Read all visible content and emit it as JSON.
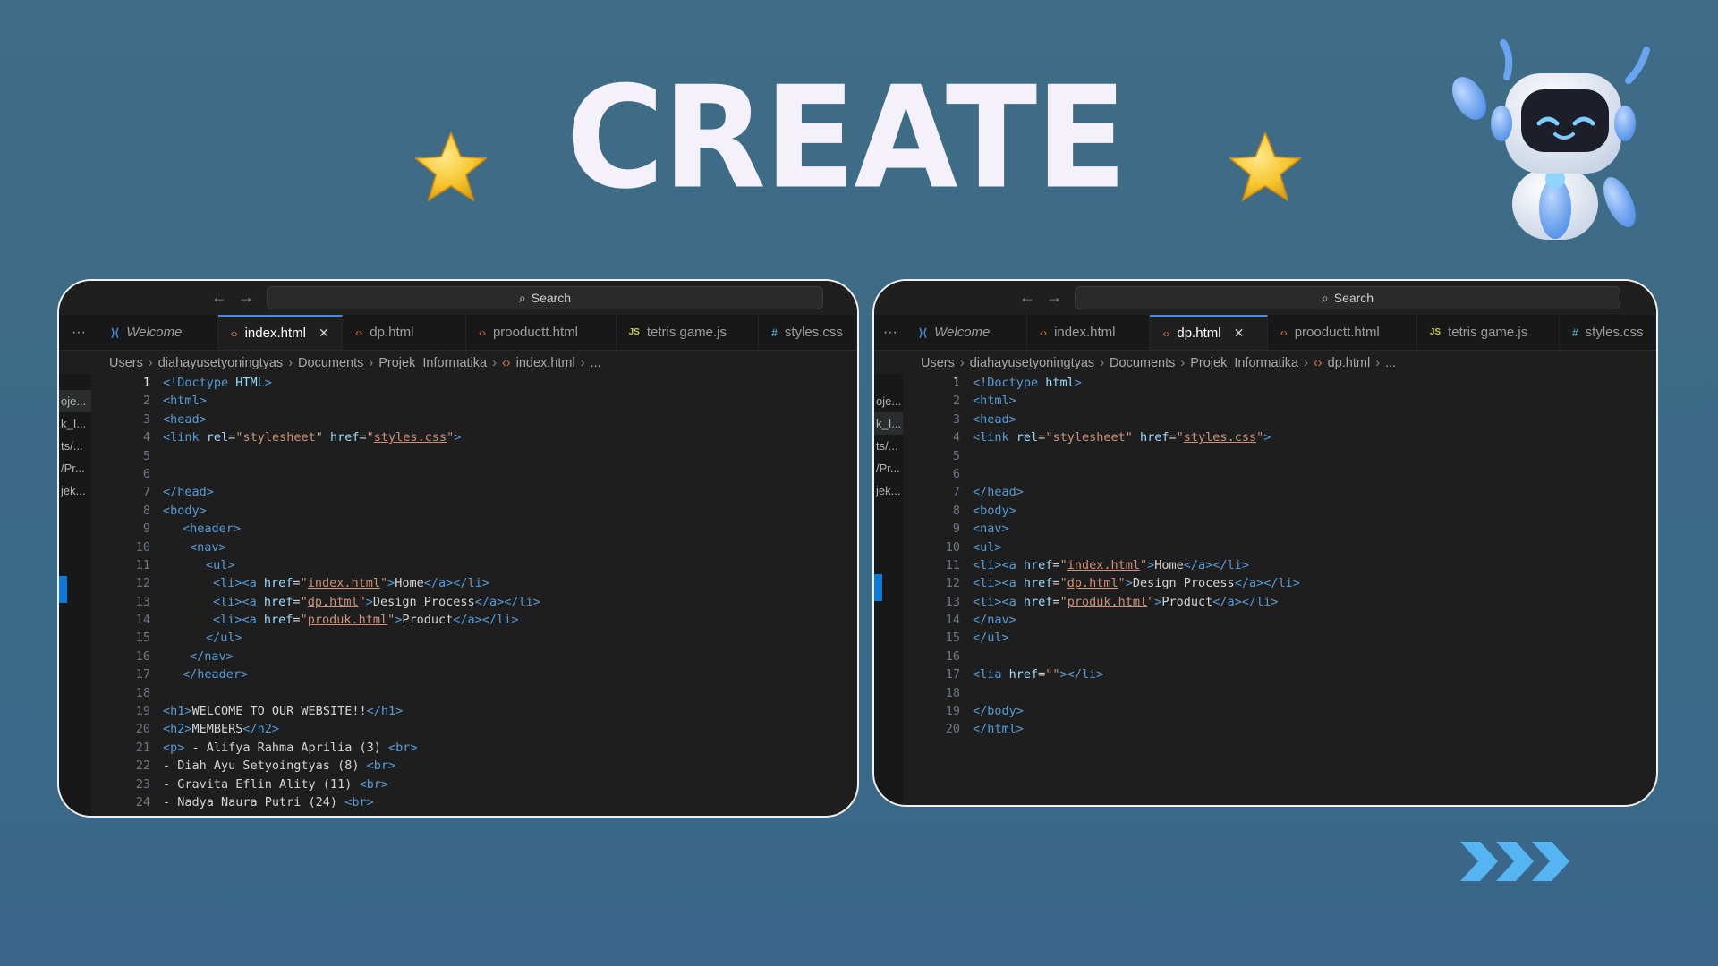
{
  "headline": "CREATE",
  "search_label": "Search",
  "tabs": [
    {
      "label": "Welcome",
      "icon": "vscode-icon"
    },
    {
      "label": "index.html",
      "icon": "html-icon"
    },
    {
      "label": "dp.html",
      "icon": "html-icon"
    },
    {
      "label": "prooductt.html",
      "icon": "html-icon"
    },
    {
      "label": "tetris game.js",
      "icon": "js-icon"
    },
    {
      "label": "styles.css",
      "icon": "css-icon"
    }
  ],
  "sidebar_items": [
    "oje...",
    "k_I...",
    "ts/...",
    "/Pr...",
    "jek..."
  ],
  "left_window": {
    "active_tab": "index.html",
    "breadcrumb": [
      "Users",
      "diahayusetyoningtyas",
      "Documents",
      "Projek_Informatika",
      "index.html",
      "..."
    ],
    "lines": [
      [
        [
          "tag",
          "<!Doctype "
        ],
        [
          "attr",
          "HTML"
        ],
        [
          "tag",
          ">"
        ]
      ],
      [
        [
          "tag",
          "<html>"
        ]
      ],
      [
        [
          "tag",
          "<head>"
        ]
      ],
      [
        [
          "tag",
          "<link "
        ],
        [
          "attr",
          "rel"
        ],
        [
          "txt",
          "="
        ],
        [
          "str",
          "\"stylesheet\""
        ],
        [
          "txt",
          " "
        ],
        [
          "attr",
          "href"
        ],
        [
          "txt",
          "="
        ],
        [
          "str",
          "\""
        ],
        [
          "link",
          "styles.css"
        ],
        [
          "str",
          "\""
        ],
        [
          "tag",
          ">"
        ]
      ],
      [],
      [],
      [
        [
          "tag",
          "</head>"
        ]
      ],
      [
        [
          "tag",
          "<body>"
        ]
      ],
      [
        [
          "ind1",
          ""
        ],
        [
          "tag",
          "<header>"
        ]
      ],
      [
        [
          "ind2",
          ""
        ],
        [
          "tag",
          "<nav>"
        ]
      ],
      [
        [
          "ind3",
          ""
        ],
        [
          "tag",
          "<ul>"
        ]
      ],
      [
        [
          "ind4",
          ""
        ],
        [
          "tag",
          "<li><a "
        ],
        [
          "attr",
          "href"
        ],
        [
          "txt",
          "="
        ],
        [
          "str",
          "\""
        ],
        [
          "link",
          "index.html"
        ],
        [
          "str",
          "\""
        ],
        [
          "tag",
          ">"
        ],
        [
          "txt",
          "Home"
        ],
        [
          "tag",
          "</a></li>"
        ]
      ],
      [
        [
          "ind4",
          ""
        ],
        [
          "tag",
          "<li><a "
        ],
        [
          "attr",
          "href"
        ],
        [
          "txt",
          "="
        ],
        [
          "str",
          "\""
        ],
        [
          "link",
          "dp.html"
        ],
        [
          "str",
          "\""
        ],
        [
          "tag",
          ">"
        ],
        [
          "txt",
          "Design Process"
        ],
        [
          "tag",
          "</a></li>"
        ]
      ],
      [
        [
          "ind4",
          ""
        ],
        [
          "tag",
          "<li><a "
        ],
        [
          "attr",
          "href"
        ],
        [
          "txt",
          "="
        ],
        [
          "str",
          "\""
        ],
        [
          "link",
          "produk.html"
        ],
        [
          "str",
          "\""
        ],
        [
          "tag",
          ">"
        ],
        [
          "txt",
          "Product"
        ],
        [
          "tag",
          "</a></li>"
        ]
      ],
      [
        [
          "ind3",
          ""
        ],
        [
          "tag",
          "</ul>"
        ]
      ],
      [
        [
          "ind2",
          ""
        ],
        [
          "tag",
          "</nav>"
        ]
      ],
      [
        [
          "ind1",
          ""
        ],
        [
          "tag",
          "</header>"
        ]
      ],
      [],
      [
        [
          "tag",
          "<h1>"
        ],
        [
          "txt",
          "WELCOME TO OUR WEBSITE!!"
        ],
        [
          "tag",
          "</h1>"
        ]
      ],
      [
        [
          "tag",
          "<h2>"
        ],
        [
          "txt",
          "MEMBERS"
        ],
        [
          "tag",
          "</h2>"
        ]
      ],
      [
        [
          "tag",
          "<p>"
        ],
        [
          "txt",
          " - Alifya Rahma Aprilia (3) "
        ],
        [
          "tag",
          "<br>"
        ]
      ],
      [
        [
          "txt",
          "- Diah Ayu Setyoingtyas (8) "
        ],
        [
          "tag",
          "<br>"
        ]
      ],
      [
        [
          "txt",
          "- Gravita Eflin Ality (11) "
        ],
        [
          "tag",
          "<br>"
        ]
      ],
      [
        [
          "txt",
          "- Nadya Naura Putri (24) "
        ],
        [
          "tag",
          "<br>"
        ]
      ]
    ]
  },
  "right_window": {
    "active_tab": "dp.html",
    "breadcrumb": [
      "Users",
      "diahayusetyoningtyas",
      "Documents",
      "Projek_Informatika",
      "dp.html",
      "..."
    ],
    "lines": [
      [
        [
          "tag",
          "<!Doctype "
        ],
        [
          "attr",
          "html"
        ],
        [
          "tag",
          ">"
        ]
      ],
      [
        [
          "tag",
          "<html>"
        ]
      ],
      [
        [
          "tag",
          "<head>"
        ]
      ],
      [
        [
          "tag",
          "<link "
        ],
        [
          "attr",
          "rel"
        ],
        [
          "txt",
          "="
        ],
        [
          "str",
          "\"stylesheet\""
        ],
        [
          "txt",
          " "
        ],
        [
          "attr",
          "href"
        ],
        [
          "txt",
          "="
        ],
        [
          "str",
          "\""
        ],
        [
          "link",
          "styles.css"
        ],
        [
          "str",
          "\""
        ],
        [
          "tag",
          ">"
        ]
      ],
      [],
      [],
      [
        [
          "tag",
          "</head>"
        ]
      ],
      [
        [
          "tag",
          "<body>"
        ]
      ],
      [
        [
          "tag",
          "<nav>"
        ]
      ],
      [
        [
          "tag",
          "<ul>"
        ]
      ],
      [
        [
          "tag",
          "<li><a "
        ],
        [
          "attr",
          "href"
        ],
        [
          "txt",
          "="
        ],
        [
          "str",
          "\""
        ],
        [
          "link",
          "index.html"
        ],
        [
          "str",
          "\""
        ],
        [
          "tag",
          ">"
        ],
        [
          "txt",
          "Home"
        ],
        [
          "tag",
          "</a></li>"
        ]
      ],
      [
        [
          "tag",
          "<li><a "
        ],
        [
          "attr",
          "href"
        ],
        [
          "txt",
          "="
        ],
        [
          "str",
          "\""
        ],
        [
          "link",
          "dp.html"
        ],
        [
          "str",
          "\""
        ],
        [
          "tag",
          ">"
        ],
        [
          "txt",
          "Design Process"
        ],
        [
          "tag",
          "</a></li>"
        ]
      ],
      [
        [
          "tag",
          "<li><a "
        ],
        [
          "attr",
          "href"
        ],
        [
          "txt",
          "="
        ],
        [
          "str",
          "\""
        ],
        [
          "link",
          "produk.html"
        ],
        [
          "str",
          "\""
        ],
        [
          "tag",
          ">"
        ],
        [
          "txt",
          "Product"
        ],
        [
          "tag",
          "</a></li>"
        ]
      ],
      [
        [
          "tag",
          "</nav>"
        ]
      ],
      [
        [
          "tag",
          "</ul>"
        ]
      ],
      [],
      [
        [
          "tag",
          "<lia "
        ],
        [
          "attr",
          "href"
        ],
        [
          "txt",
          "="
        ],
        [
          "str",
          "\"\""
        ],
        [
          "tag",
          "></li>"
        ]
      ],
      [],
      [
        [
          "tag",
          "</body>"
        ]
      ],
      [
        [
          "tag",
          "</html>"
        ]
      ]
    ]
  },
  "colors": {
    "background": "#3d6a85",
    "editor_bg": "#1e1e1f",
    "accent": "#3b8eea",
    "headline": "#f4f1fb",
    "star": "#f7c62f"
  }
}
